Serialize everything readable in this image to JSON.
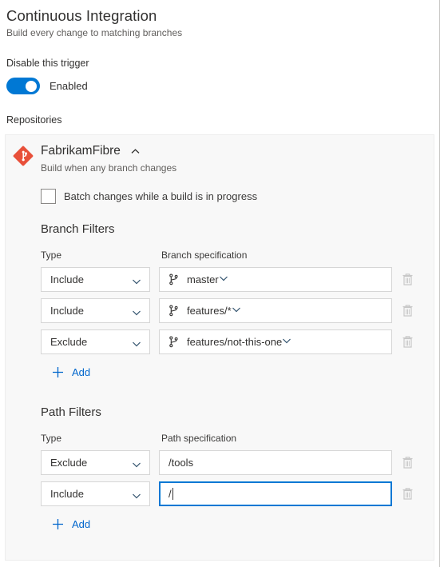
{
  "header": {
    "title": "Continuous Integration",
    "subtitle": "Build every change to matching branches"
  },
  "trigger": {
    "label": "Disable this trigger",
    "toggle_state_text": "Enabled",
    "toggle_on": true,
    "accent_color": "#0078d4"
  },
  "repositories": {
    "label": "Repositories",
    "repo": {
      "name": "FabrikamFibre",
      "icon": "git-repository-icon",
      "collapse_icon": "chevron-up-icon",
      "description": "Build when any branch changes",
      "batch_checkbox": {
        "label": "Batch changes while a build is in progress",
        "checked": false
      }
    }
  },
  "branch_filters": {
    "title": "Branch Filters",
    "col_type": "Type",
    "col_spec": "Branch specification",
    "rows": [
      {
        "type": "Include",
        "spec": "master",
        "icon": "git-branch-icon",
        "focused": false
      },
      {
        "type": "Include",
        "spec": "features/*",
        "icon": "git-branch-icon",
        "focused": false
      },
      {
        "type": "Exclude",
        "spec": "features/not-this-one",
        "icon": "git-branch-icon",
        "focused": false
      }
    ],
    "add_label": "Add"
  },
  "path_filters": {
    "title": "Path Filters",
    "col_type": "Type",
    "col_spec": "Path specification",
    "rows": [
      {
        "type": "Exclude",
        "spec": "/tools",
        "focused": false
      },
      {
        "type": "Include",
        "spec": "/",
        "focused": true
      }
    ],
    "add_label": "Add"
  }
}
